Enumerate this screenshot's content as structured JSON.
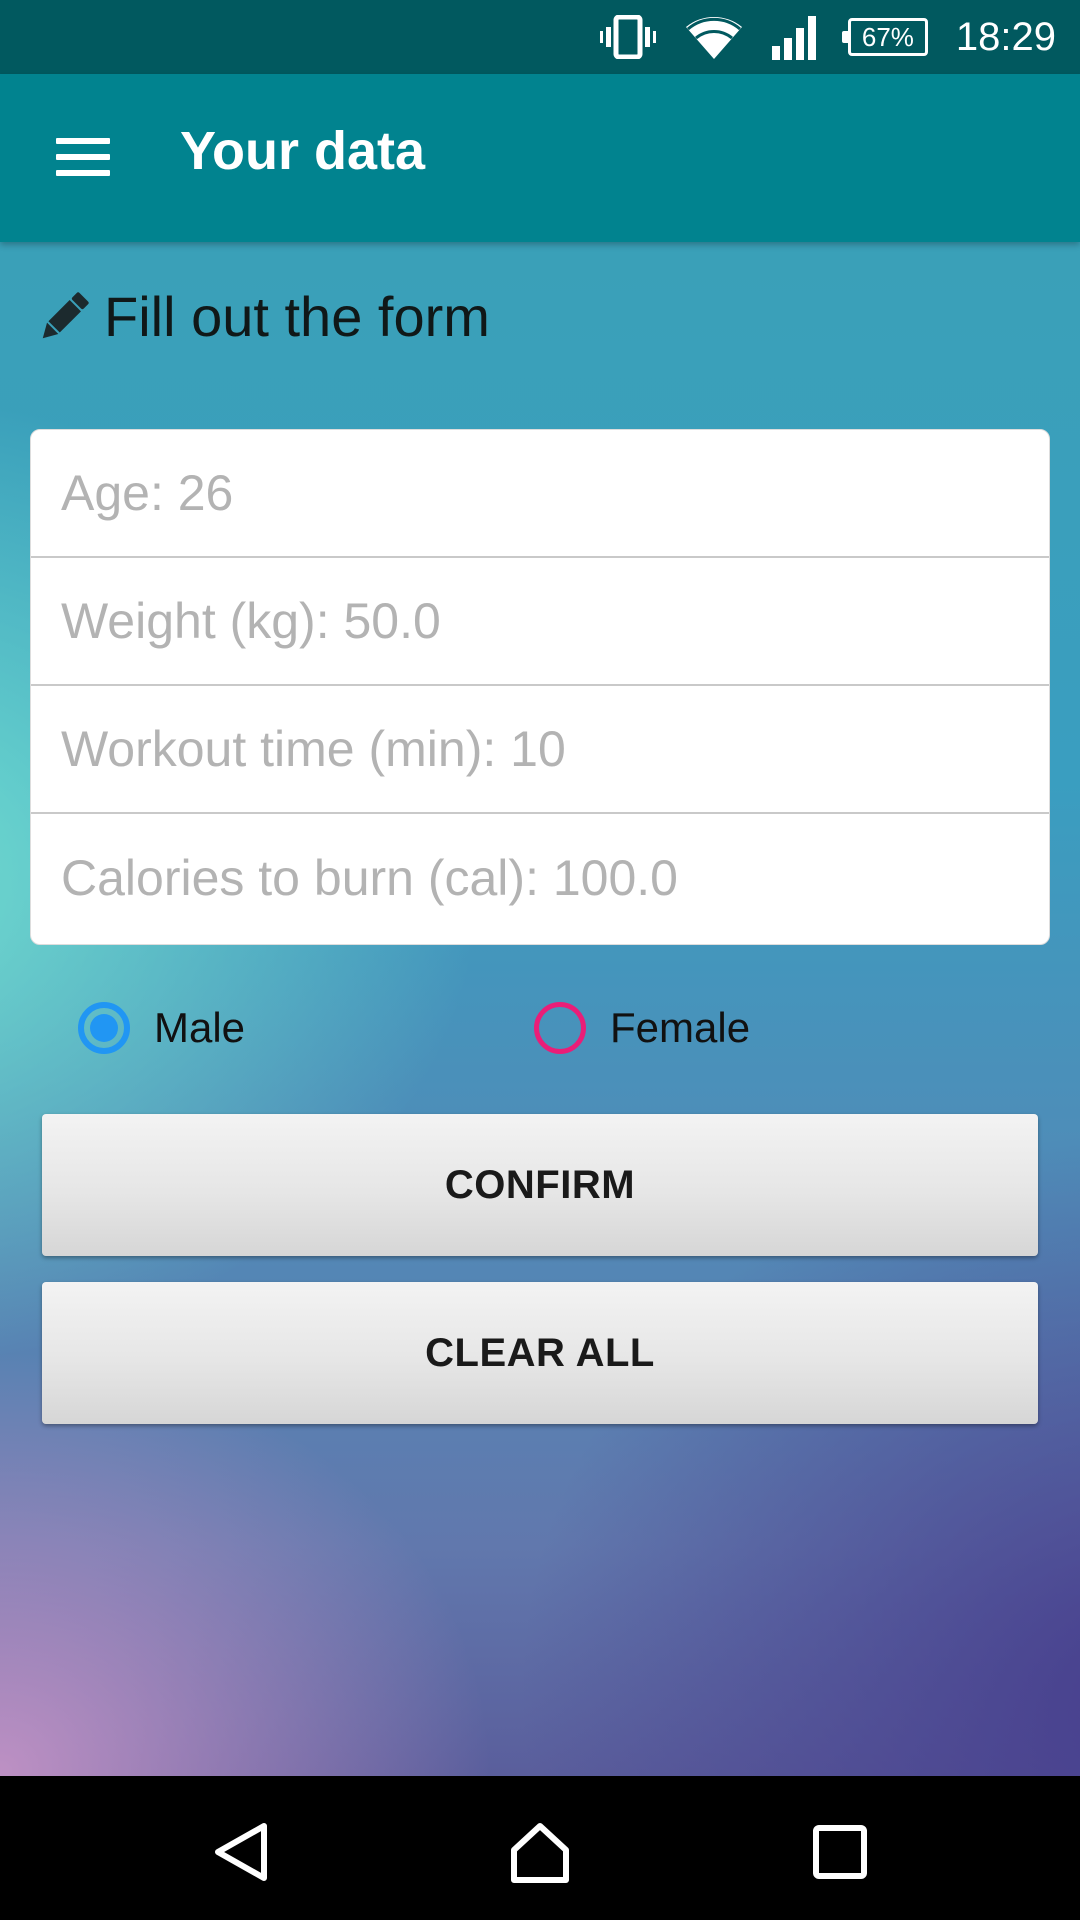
{
  "status_bar": {
    "battery_percent": "67%",
    "time": "18:29",
    "icons": [
      "vibrate-icon",
      "wifi-icon",
      "signal-icon",
      "battery-icon"
    ]
  },
  "app_bar": {
    "title": "Your data",
    "menu_icon": "menu-icon"
  },
  "form": {
    "heading": "Fill out the form",
    "heading_icon": "pencil-icon",
    "fields": [
      {
        "placeholder": "Age: 26",
        "value": ""
      },
      {
        "placeholder": "Weight (kg): 50.0",
        "value": ""
      },
      {
        "placeholder": "Workout time (min): 10",
        "value": ""
      },
      {
        "placeholder": "Calories to burn (cal): 100.0",
        "value": ""
      }
    ],
    "gender": {
      "options": [
        {
          "label": "Male",
          "checked": true
        },
        {
          "label": "Female",
          "checked": false
        }
      ]
    },
    "confirm_label": "CONFIRM",
    "clear_label": "CLEAR ALL"
  },
  "colors": {
    "status_bar": "#01595f",
    "app_bar": "#01838f",
    "radio_checked": "#2196f3",
    "radio_unchecked": "#e91e78"
  },
  "nav_bar": {
    "icons": [
      "back-icon",
      "home-icon",
      "recent-apps-icon"
    ]
  }
}
